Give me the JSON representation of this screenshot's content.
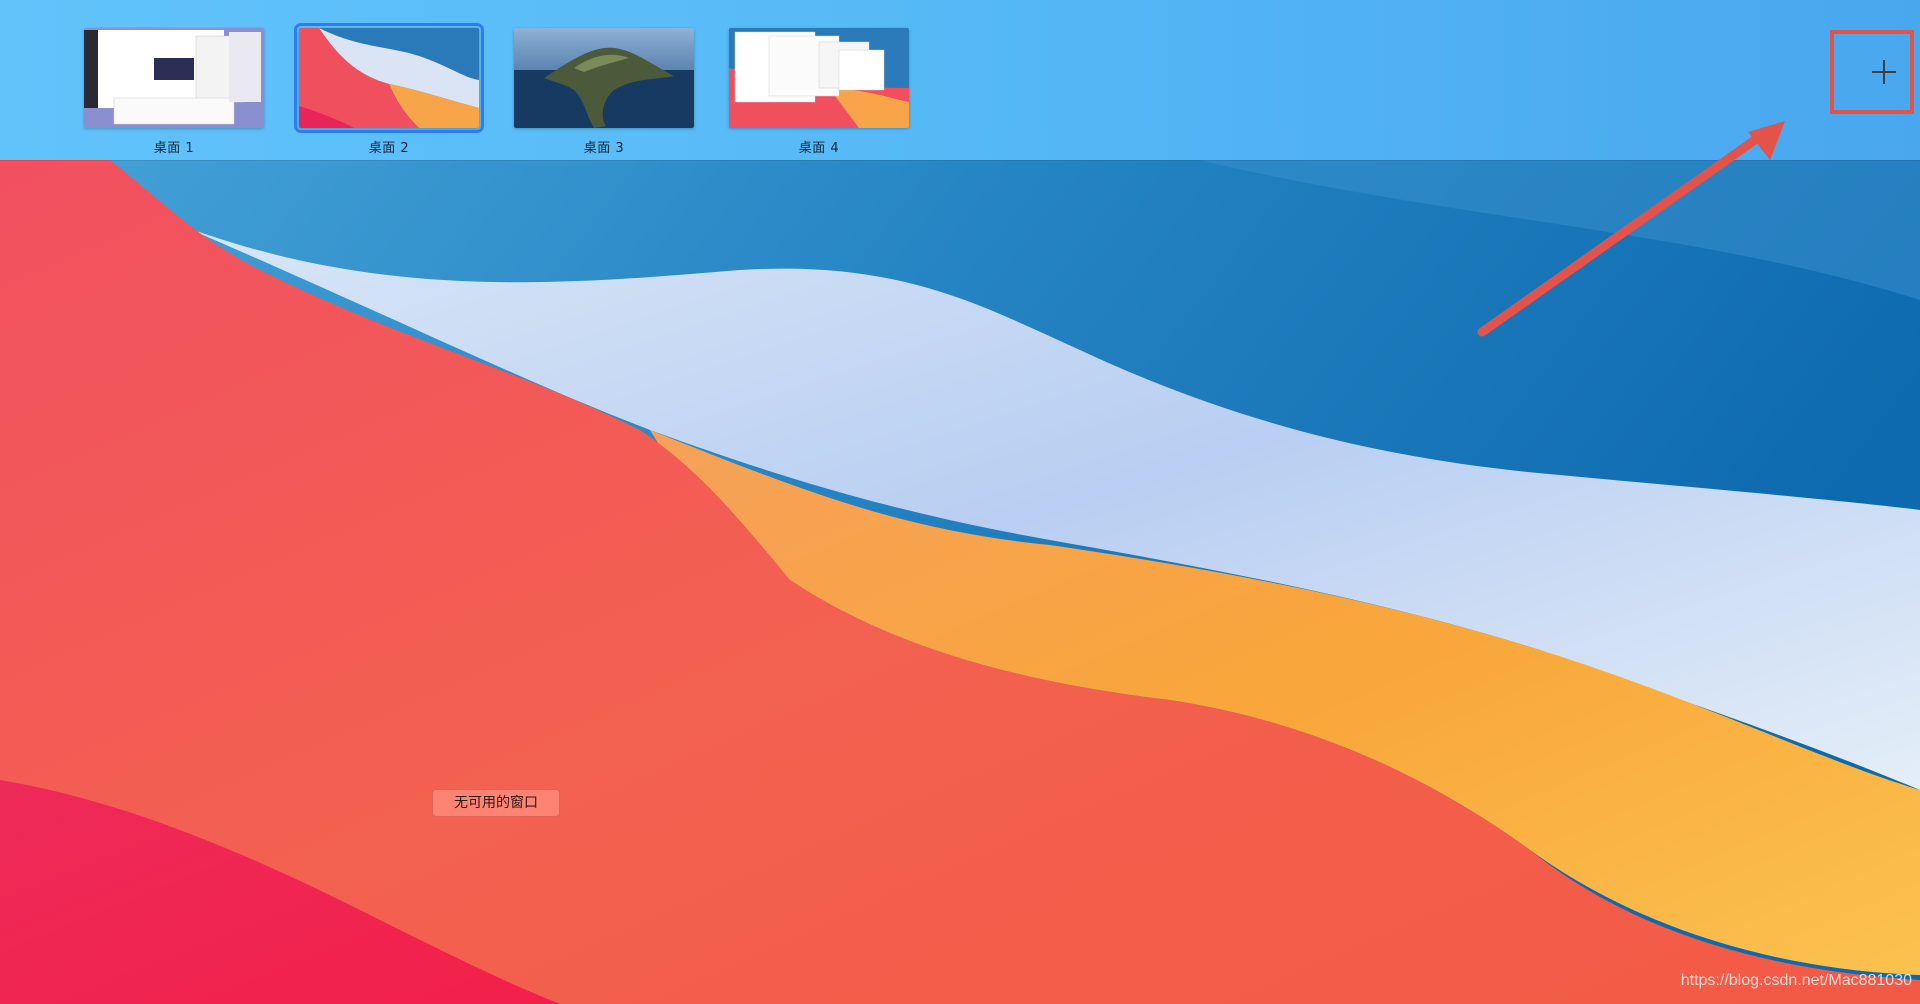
{
  "spaces": [
    {
      "label": "桌面 1",
      "selected": false
    },
    {
      "label": "桌面 2",
      "selected": true
    },
    {
      "label": "桌面 3",
      "selected": false
    },
    {
      "label": "桌面 4",
      "selected": false
    }
  ],
  "add_space": {
    "icon": "plus-icon"
  },
  "desktop": {
    "no_windows_label": "无可用的窗口"
  },
  "watermark": "https://blog.csdn.net/Mac881030",
  "colors": {
    "bar": "#5bbdf8",
    "selection": "#2f7cf0",
    "annotation": "#e3534a"
  }
}
